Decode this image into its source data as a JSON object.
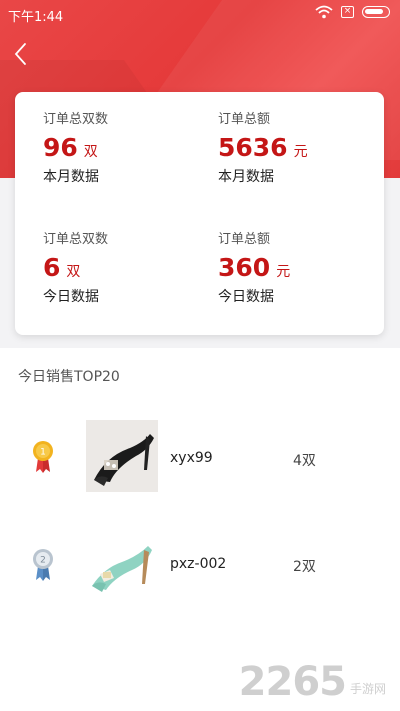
{
  "status_bar": {
    "time": "下午1:44",
    "sim_label": "×"
  },
  "stats": [
    {
      "label": "订单总双数",
      "value": "96",
      "unit": "双",
      "sub": "本月数据"
    },
    {
      "label": "订单总额",
      "value": "5636",
      "unit": "元",
      "sub": "本月数据"
    },
    {
      "label": "订单总双数",
      "value": "6",
      "unit": "双",
      "sub": "今日数据"
    },
    {
      "label": "订单总额",
      "value": "360",
      "unit": "元",
      "sub": "今日数据"
    }
  ],
  "ranking": {
    "title": "今日销售TOP20",
    "items": [
      {
        "rank_icon": "gold-medal-icon",
        "rank": "1",
        "image": "black-heel-shoe-image",
        "name": "xyx99",
        "qty": "4双"
      },
      {
        "rank_icon": "silver-medal-icon",
        "rank": "2",
        "image": "mint-heel-shoe-image",
        "name": "pxz-002",
        "qty": "2双"
      }
    ]
  },
  "watermark": {
    "number": "2265",
    "site": "手游网"
  },
  "colors": {
    "header_red": "#e53a3a",
    "value_red": "#c41616",
    "gold": "#f2b31f",
    "silver_blue": "#5b8fc7"
  }
}
